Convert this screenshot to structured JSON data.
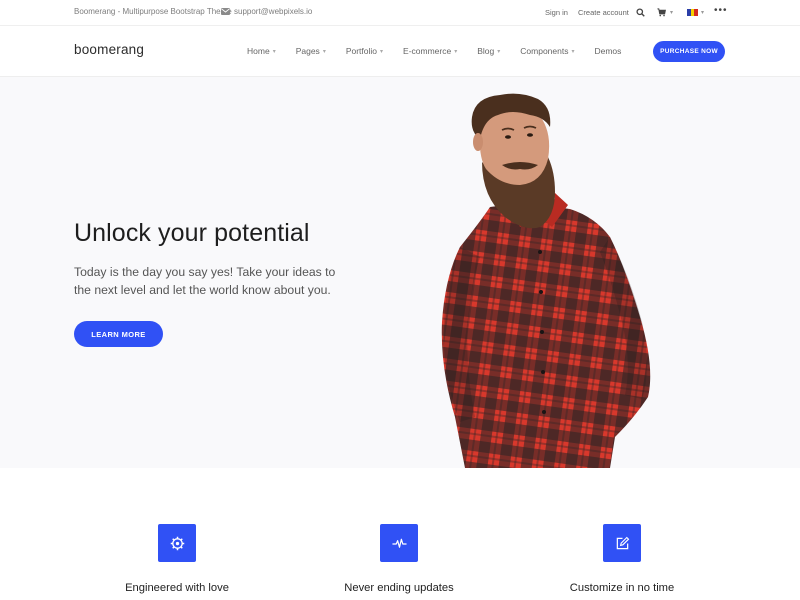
{
  "topbar": {
    "tagline": "Boomerang - Multipurpose Bootstrap Theme",
    "email": "support@webpixels.io",
    "signin": "Sign in",
    "create_account": "Create account",
    "more": "•••"
  },
  "header": {
    "logo": "boomerang",
    "nav": [
      {
        "label": "Home",
        "has_dropdown": true
      },
      {
        "label": "Pages",
        "has_dropdown": true
      },
      {
        "label": "Portfolio",
        "has_dropdown": true
      },
      {
        "label": "E-commerce",
        "has_dropdown": true
      },
      {
        "label": "Blog",
        "has_dropdown": true
      },
      {
        "label": "Components",
        "has_dropdown": true
      },
      {
        "label": "Demos",
        "has_dropdown": false
      }
    ],
    "purchase": "PURCHASE NOW"
  },
  "hero": {
    "title": "Unlock your potential",
    "text": "Today is the day you say yes! Take your ideas to the next level and let the world know about you.",
    "button": "LEARN MORE"
  },
  "features": [
    {
      "title": "Engineered with love",
      "icon": "gear-icon"
    },
    {
      "title": "Never ending updates",
      "icon": "pulse-icon"
    },
    {
      "title": "Customize in no time",
      "icon": "edit-icon"
    }
  ],
  "colors": {
    "accent": "#3051f5",
    "hero_bg": "#f9f9fb",
    "shirt_red": "#d8382c",
    "shirt_dark": "#2a2424"
  }
}
